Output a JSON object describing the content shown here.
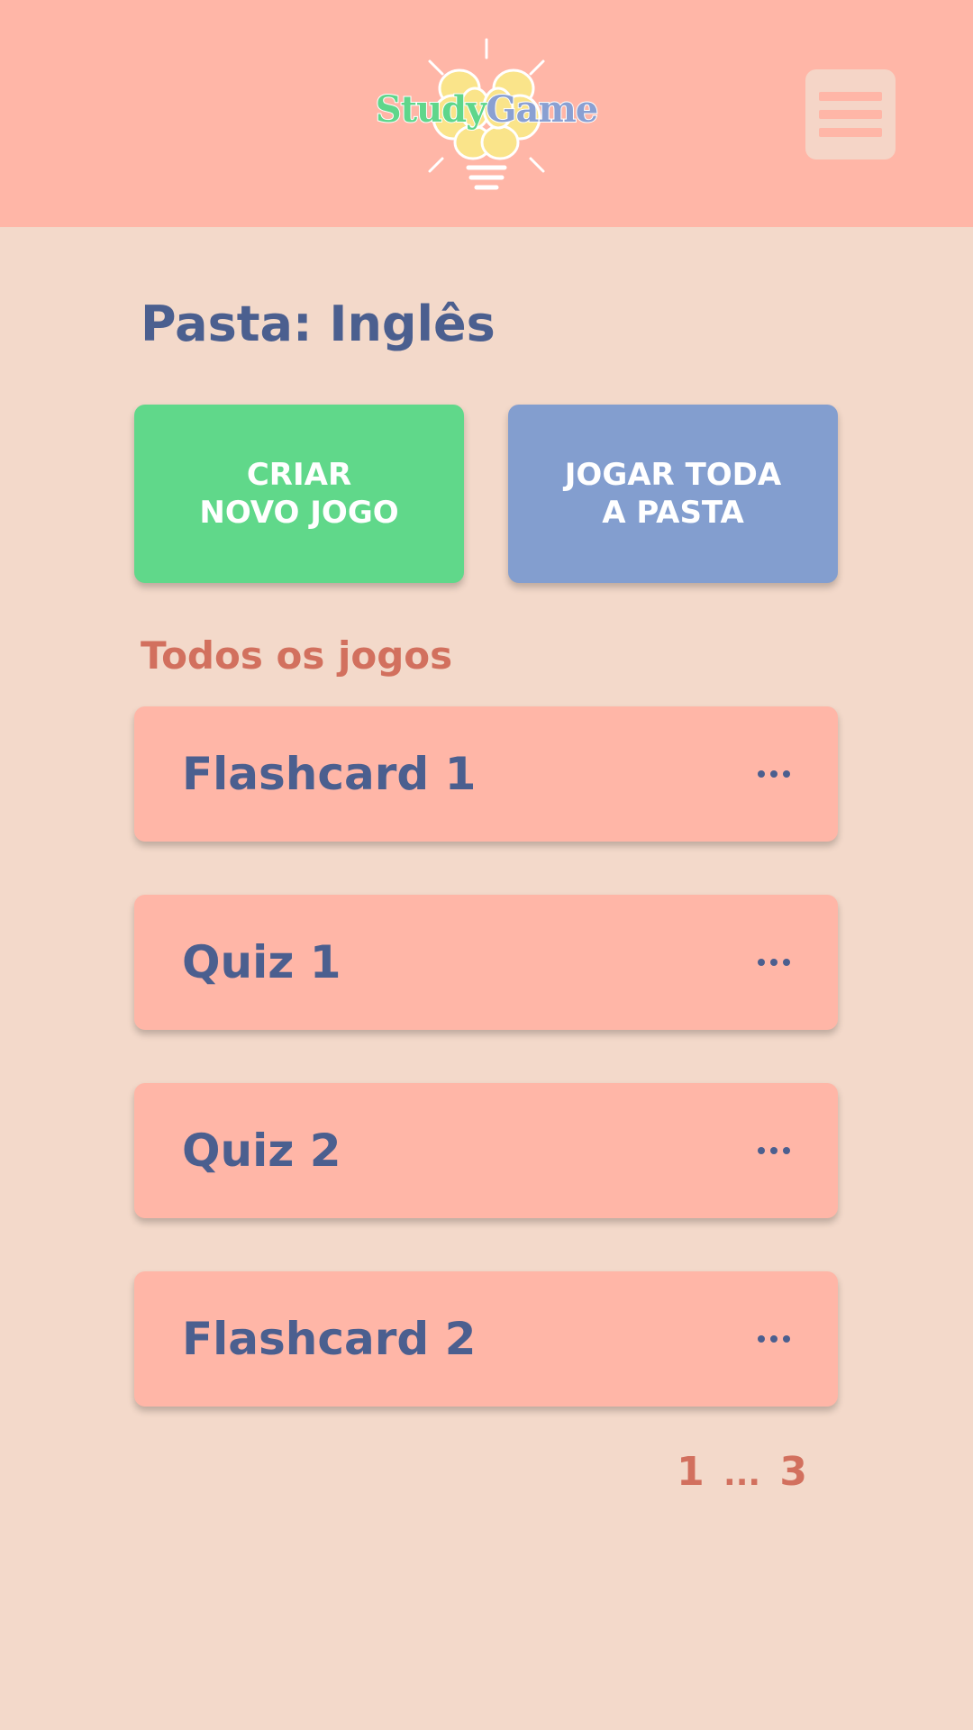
{
  "header": {
    "logo": {
      "text_part1": "Study",
      "text_part2": "Game",
      "icon": "brain-lightbulb-icon"
    },
    "menu_icon": "hamburger-menu-icon"
  },
  "page": {
    "title": "Pasta: Inglês"
  },
  "actions": {
    "create_line1": "CRIAR",
    "create_line2": "NOVO JOGO",
    "play_line1": "JOGAR TODA",
    "play_line2": "A PASTA"
  },
  "games_section": {
    "title": "Todos os jogos",
    "more_icon": "more-horizontal-icon",
    "items": [
      {
        "name": "Flashcard 1"
      },
      {
        "name": "Quiz 1"
      },
      {
        "name": "Quiz 2"
      },
      {
        "name": "Flashcard 2"
      }
    ]
  },
  "pagination": {
    "current": "1",
    "separator": "...",
    "last": "3"
  },
  "colors": {
    "header_bg": "#ffb6a7",
    "page_bg": "#f3d9ca",
    "create_button": "#60d88a",
    "play_button": "#839ecf",
    "title_text": "#4b5f8f",
    "accent_text": "#d2705e"
  }
}
